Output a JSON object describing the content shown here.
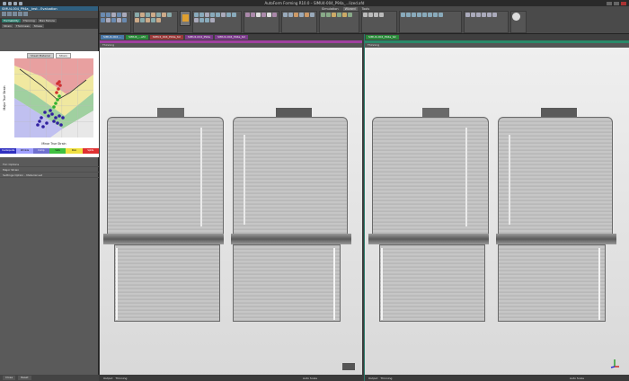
{
  "app": {
    "title": "AutoForm Forming R10.0 – SIMU4-004_P94a_...lized.afd"
  },
  "ribbon": {
    "menu_tabs": [
      "Simulation",
      "Wizard",
      "Tools"
    ],
    "active_menu": "Wizard"
  },
  "left_panel": {
    "header": "SIMU4-004_P94a__test - Evaluation",
    "tabs": [
      "Formability",
      "Thinning",
      "Max Failure",
      "Strain",
      "Thickness",
      "Stress"
    ],
    "flc_tabs": [
      "Sheet Material",
      "Strain"
    ],
    "legend": [
      "Inadequate",
      "Wrinkle",
      "Comp",
      "Safe",
      "Risk",
      "Splits"
    ],
    "legend_colors": [
      "#3030c0",
      "#a0a0ff",
      "#7070d0",
      "#40c040",
      "#f0e040",
      "#e03030"
    ],
    "rows": [
      "FLC Options",
      "Major Strain",
      "Settings Option - Material set"
    ],
    "bottom_buttons": [
      "Close",
      "Reset"
    ]
  },
  "chart_data": {
    "type": "scatter",
    "title": "",
    "xlabel": "Minor True Strain",
    "ylabel": "Major True Strain",
    "zones": [
      {
        "name": "Splits",
        "color": "#e8a0a0"
      },
      {
        "name": "Risk",
        "color": "#f0e8a0"
      },
      {
        "name": "Safe",
        "color": "#a0d0a0"
      },
      {
        "name": "Compression",
        "color": "#c0c0f0"
      },
      {
        "name": "Inadequate",
        "color": "#e0e0e0"
      }
    ],
    "grid": true
  },
  "views": [
    {
      "tabs": [
        "SIMU4-004 ...",
        "SIMU4_...afd",
        "SIMU4_004_P94a_tst",
        "SIMU4-004_P94a",
        "SIMU4-004_P94a_tst"
      ],
      "header": "Thinning",
      "footer_items": [
        "Output",
        "Thinning",
        "Auto Scale"
      ]
    },
    {
      "tabs": [
        "SIMU4-004_P94a_tst"
      ],
      "header": "Thinning",
      "footer_items": [
        "Output",
        "Thinning",
        "Auto Scale"
      ]
    }
  ]
}
